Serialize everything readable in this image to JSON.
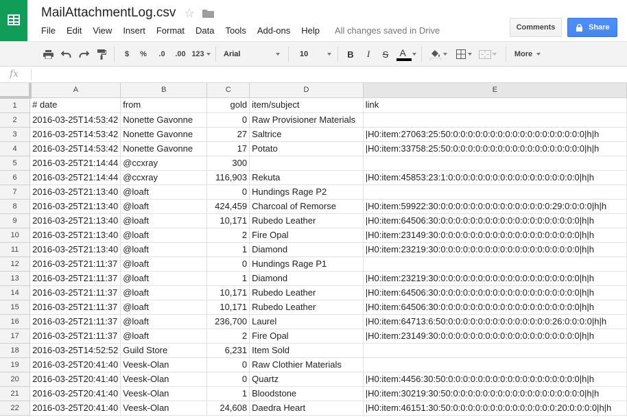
{
  "app": {
    "doc_title": "MailAttachmentLog.csv",
    "menu": [
      "File",
      "Edit",
      "View",
      "Insert",
      "Format",
      "Data",
      "Tools",
      "Add-ons",
      "Help"
    ],
    "save_status": "All changes saved in Drive",
    "comments_label": "Comments",
    "share_label": "Share",
    "brand_color": "#0f9d58",
    "share_color": "#4d90fe"
  },
  "toolbar": {
    "currency": "$",
    "percent": "%",
    "dec_decrease": ".0",
    "dec_increase": ".00",
    "more_formats": "123",
    "font": "Arial",
    "font_size": "10",
    "bold": "B",
    "italic": "I",
    "strike": "S",
    "text_color": "A",
    "more": "More"
  },
  "formula_bar": {
    "fx": "fx",
    "value": ""
  },
  "sheet": {
    "columns": [
      "A",
      "B",
      "C",
      "D",
      "E"
    ],
    "rows": [
      {
        "n": "1",
        "date": "# date",
        "from": "from",
        "gold": "gold",
        "item": "item/subject",
        "link": "link"
      },
      {
        "n": "2",
        "date": "2016-03-25T14:53:42",
        "from": "Nonette Gavonne",
        "gold": "0",
        "item": "Raw Provisioner Materials",
        "link": ""
      },
      {
        "n": "3",
        "date": "2016-03-25T14:53:42",
        "from": "Nonette Gavonne",
        "gold": "27",
        "item": "Saltrice",
        "link": "|H0:item:27063:25:50:0:0:0:0:0:0:0:0:0:0:0:0:0:0:0:0:0:0|h|h"
      },
      {
        "n": "4",
        "date": "2016-03-25T14:53:42",
        "from": "Nonette Gavonne",
        "gold": "17",
        "item": "Potato",
        "link": "|H0:item:33758:25:50:0:0:0:0:0:0:0:0:0:0:0:0:0:0:0:0:0:0|h|h"
      },
      {
        "n": "5",
        "date": "2016-03-25T21:14:44",
        "from": "@ccxray",
        "gold": "300",
        "item": "",
        "link": ""
      },
      {
        "n": "6",
        "date": "2016-03-25T21:14:44",
        "from": "@ccxray",
        "gold": "116,903",
        "item": "Rekuta",
        "link": "|H0:item:45853:23:1:0:0:0:0:0:0:0:0:0:0:0:0:0:0:0:0:0:0|h|h"
      },
      {
        "n": "7",
        "date": "2016-03-25T21:13:40",
        "from": "@loaft",
        "gold": "0",
        "item": "Hundings Rage P2",
        "link": ""
      },
      {
        "n": "8",
        "date": "2016-03-25T21:13:40",
        "from": "@loaft",
        "gold": "424,459",
        "item": "Charcoal of Remorse",
        "link": "|H0:item:59922:30:0:0:0:0:0:0:0:0:0:0:0:0:0:0:0:29:0:0:0:0|h|h"
      },
      {
        "n": "9",
        "date": "2016-03-25T21:13:40",
        "from": "@loaft",
        "gold": "10,171",
        "item": "Rubedo Leather",
        "link": "|H0:item:64506:30:0:0:0:0:0:0:0:0:0:0:0:0:0:0:0:0:0:0:0|h|h"
      },
      {
        "n": "10",
        "date": "2016-03-25T21:13:40",
        "from": "@loaft",
        "gold": "2",
        "item": "Fire Opal",
        "link": "|H0:item:23149:30:0:0:0:0:0:0:0:0:0:0:0:0:0:0:0:0:0:0:0|h|h"
      },
      {
        "n": "11",
        "date": "2016-03-25T21:13:40",
        "from": "@loaft",
        "gold": "1",
        "item": "Diamond",
        "link": "|H0:item:23219:30:0:0:0:0:0:0:0:0:0:0:0:0:0:0:0:0:0:0:0|h|h"
      },
      {
        "n": "12",
        "date": "2016-03-25T21:11:37",
        "from": "@loaft",
        "gold": "0",
        "item": "Hundings Rage P1",
        "link": ""
      },
      {
        "n": "13",
        "date": "2016-03-25T21:11:37",
        "from": "@loaft",
        "gold": "1",
        "item": "Diamond",
        "link": "|H0:item:23219:30:0:0:0:0:0:0:0:0:0:0:0:0:0:0:0:0:0:0:0|h|h"
      },
      {
        "n": "14",
        "date": "2016-03-25T21:11:37",
        "from": "@loaft",
        "gold": "10,171",
        "item": "Rubedo Leather",
        "link": "|H0:item:64506:30:0:0:0:0:0:0:0:0:0:0:0:0:0:0:0:0:0:0:0|h|h"
      },
      {
        "n": "15",
        "date": "2016-03-25T21:11:37",
        "from": "@loaft",
        "gold": "10,171",
        "item": "Rubedo Leather",
        "link": "|H0:item:64506:30:0:0:0:0:0:0:0:0:0:0:0:0:0:0:0:0:0:0:0|h|h"
      },
      {
        "n": "16",
        "date": "2016-03-25T21:11:37",
        "from": "@loaft",
        "gold": "236,700",
        "item": "Laurel",
        "link": "|H0:item:64713:6:50:0:0:0:0:0:0:0:0:0:0:0:0:0:0:26:0:0:0:0|h|h"
      },
      {
        "n": "17",
        "date": "2016-03-25T21:11:37",
        "from": "@loaft",
        "gold": "2",
        "item": "Fire Opal",
        "link": "|H0:item:23149:30:0:0:0:0:0:0:0:0:0:0:0:0:0:0:0:0:0:0:0|h|h"
      },
      {
        "n": "18",
        "date": "2016-03-25T14:52:52",
        "from": "Guild Store",
        "gold": "6,231",
        "item": "Item Sold",
        "link": ""
      },
      {
        "n": "19",
        "date": "2016-03-25T20:41:40",
        "from": "Veesk-Olan",
        "gold": "0",
        "item": "Raw Clothier Materials",
        "link": ""
      },
      {
        "n": "20",
        "date": "2016-03-25T20:41:40",
        "from": "Veesk-Olan",
        "gold": "0",
        "item": "Quartz",
        "link": "|H0:item:4456:30:50:0:0:0:0:0:0:0:0:0:0:0:0:0:0:0:0:0:0|h|h"
      },
      {
        "n": "21",
        "date": "2016-03-25T20:41:40",
        "from": "Veesk-Olan",
        "gold": "1",
        "item": "Bloodstone",
        "link": "|H0:item:30219:30:50:0:0:0:0:0:0:0:0:0:0:0:0:0:0:0:0:0:0|h|h"
      },
      {
        "n": "22",
        "date": "2016-03-25T20:41:40",
        "from": "Veesk-Olan",
        "gold": "24,608",
        "item": "Daedra Heart",
        "link": "|H0:item:46151:30:50:0:0:0:0:0:0:0:0:0:0:0:0:0:0:20:0:0:0:0|h|h"
      }
    ]
  }
}
